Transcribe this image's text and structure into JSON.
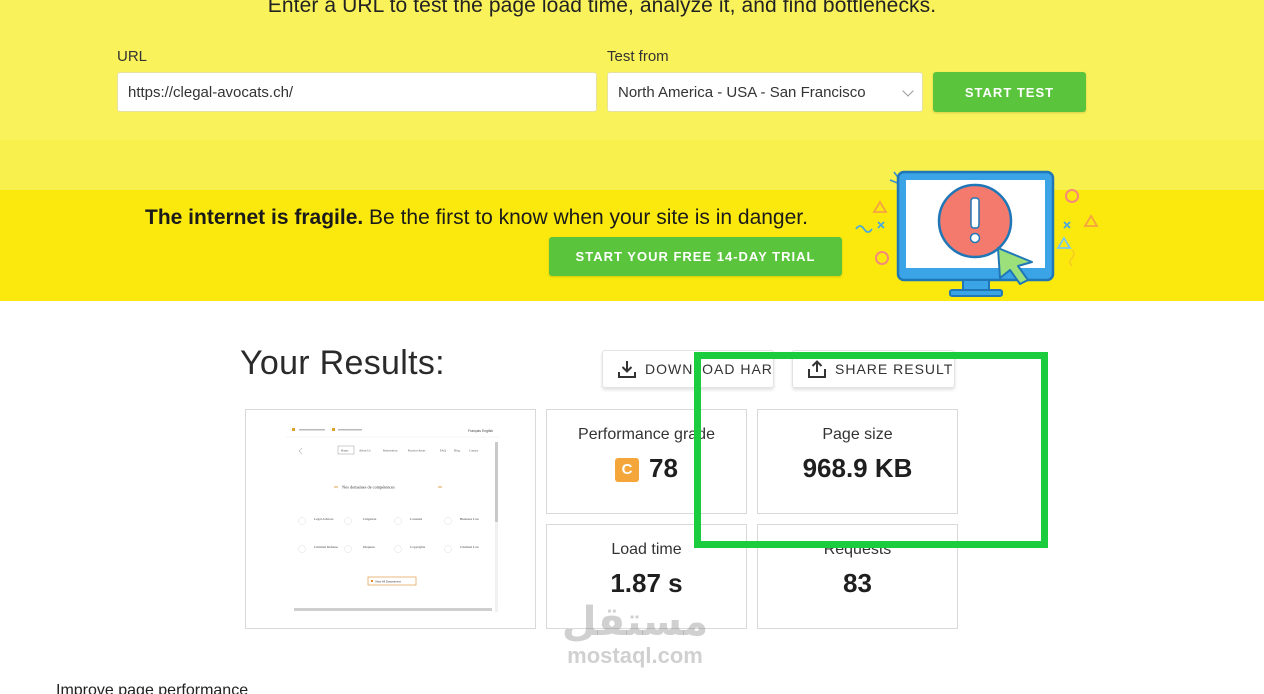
{
  "hero": {
    "tagline": "Enter a URL to test the page load time, analyze it, and find bottlenecks.",
    "url_label": "URL",
    "url_value": "https://clegal-avocats.ch/",
    "test_from_label": "Test from",
    "test_from_value": "North America - USA - San Francisco",
    "start_test_label": "START TEST"
  },
  "promo": {
    "headline_bold": "The internet is fragile.",
    "headline_rest": " Be the first to know when your site is in danger.",
    "trial_button_label": "START YOUR FREE 14-DAY TRIAL"
  },
  "results": {
    "title": "Your Results:",
    "download_har_label": "DOWNLOAD HAR",
    "share_result_label": "SHARE RESULT",
    "metrics": {
      "performance_grade": {
        "label": "Performance grade",
        "grade": "C",
        "score": "78"
      },
      "page_size": {
        "label": "Page size",
        "value": "968.9 KB"
      },
      "load_time": {
        "label": "Load time",
        "value": "1.87 s"
      },
      "requests": {
        "label": "Requests",
        "value": "83"
      }
    }
  },
  "thumbnail": {
    "heading": "Nos domaines de compétences",
    "language": "Français  English",
    "nav_items": [
      "Home",
      "About Us",
      "Reservation",
      "Practice Areas",
      "FAQ",
      "Blog",
      "Contact"
    ],
    "practice_areas": [
      "Legal Advices",
      "Litigation",
      "Lawsuits",
      "Business Law",
      "Criminal Defense",
      "Disputes",
      "Copyrights",
      "Criminal Law"
    ],
    "button_label": "View All Department"
  },
  "footer": {
    "improve_heading": "Improve page performance"
  },
  "watermark": {
    "arabic": "مستقل",
    "latin": "mostaql.com"
  },
  "colors": {
    "hero_yellow": "#f9f25a",
    "promo_yellow": "#fbe90e",
    "brand_green": "#5ac43d",
    "grade_orange": "#f4a63a",
    "highlight_green": "#1ccc3f"
  }
}
